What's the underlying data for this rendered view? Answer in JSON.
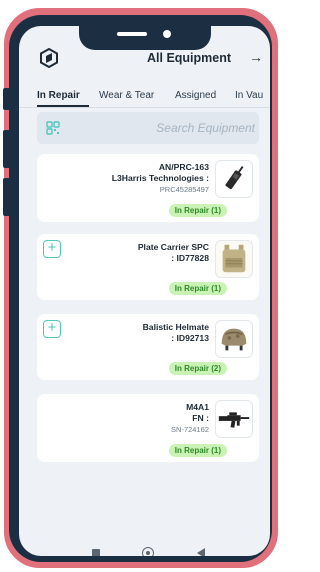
{
  "header": {
    "title": "All Equipment",
    "arrow": "→"
  },
  "tabs": [
    {
      "label": "In Repair"
    },
    {
      "label": "Wear & Tear"
    },
    {
      "label": "Assigned"
    },
    {
      "label": "In Vau"
    }
  ],
  "search": {
    "placeholder": "Search Equipment"
  },
  "cards": [
    {
      "name_line1": "AN/PRC-163",
      "name_line2": "L3Harris Technologies :",
      "serial": "PRC45285497",
      "badge": "In Repair (1)",
      "thumbnail_icon": "radio-icon"
    },
    {
      "name_line1": "Plate Carrier SPC",
      "name_line2": ": ID77828",
      "badge": "In Repair (1)",
      "thumbnail_icon": "plate-carrier-icon"
    },
    {
      "name_line1": "Balistic Helmate",
      "name_line2": ": ID92713",
      "badge": "In Repair (2)",
      "thumbnail_icon": "helmet-icon"
    },
    {
      "name_line1": "M4A1",
      "name_line2": "FN :",
      "serial": "SN-724162",
      "badge": "In Repair (1)",
      "thumbnail_icon": "rifle-icon"
    }
  ],
  "colors": {
    "accent": "#4fc7bd",
    "badge_bg": "#c9f2b4",
    "badge_text": "#2f8a2a",
    "frame": "#e0707c",
    "device": "#1c2f42"
  }
}
